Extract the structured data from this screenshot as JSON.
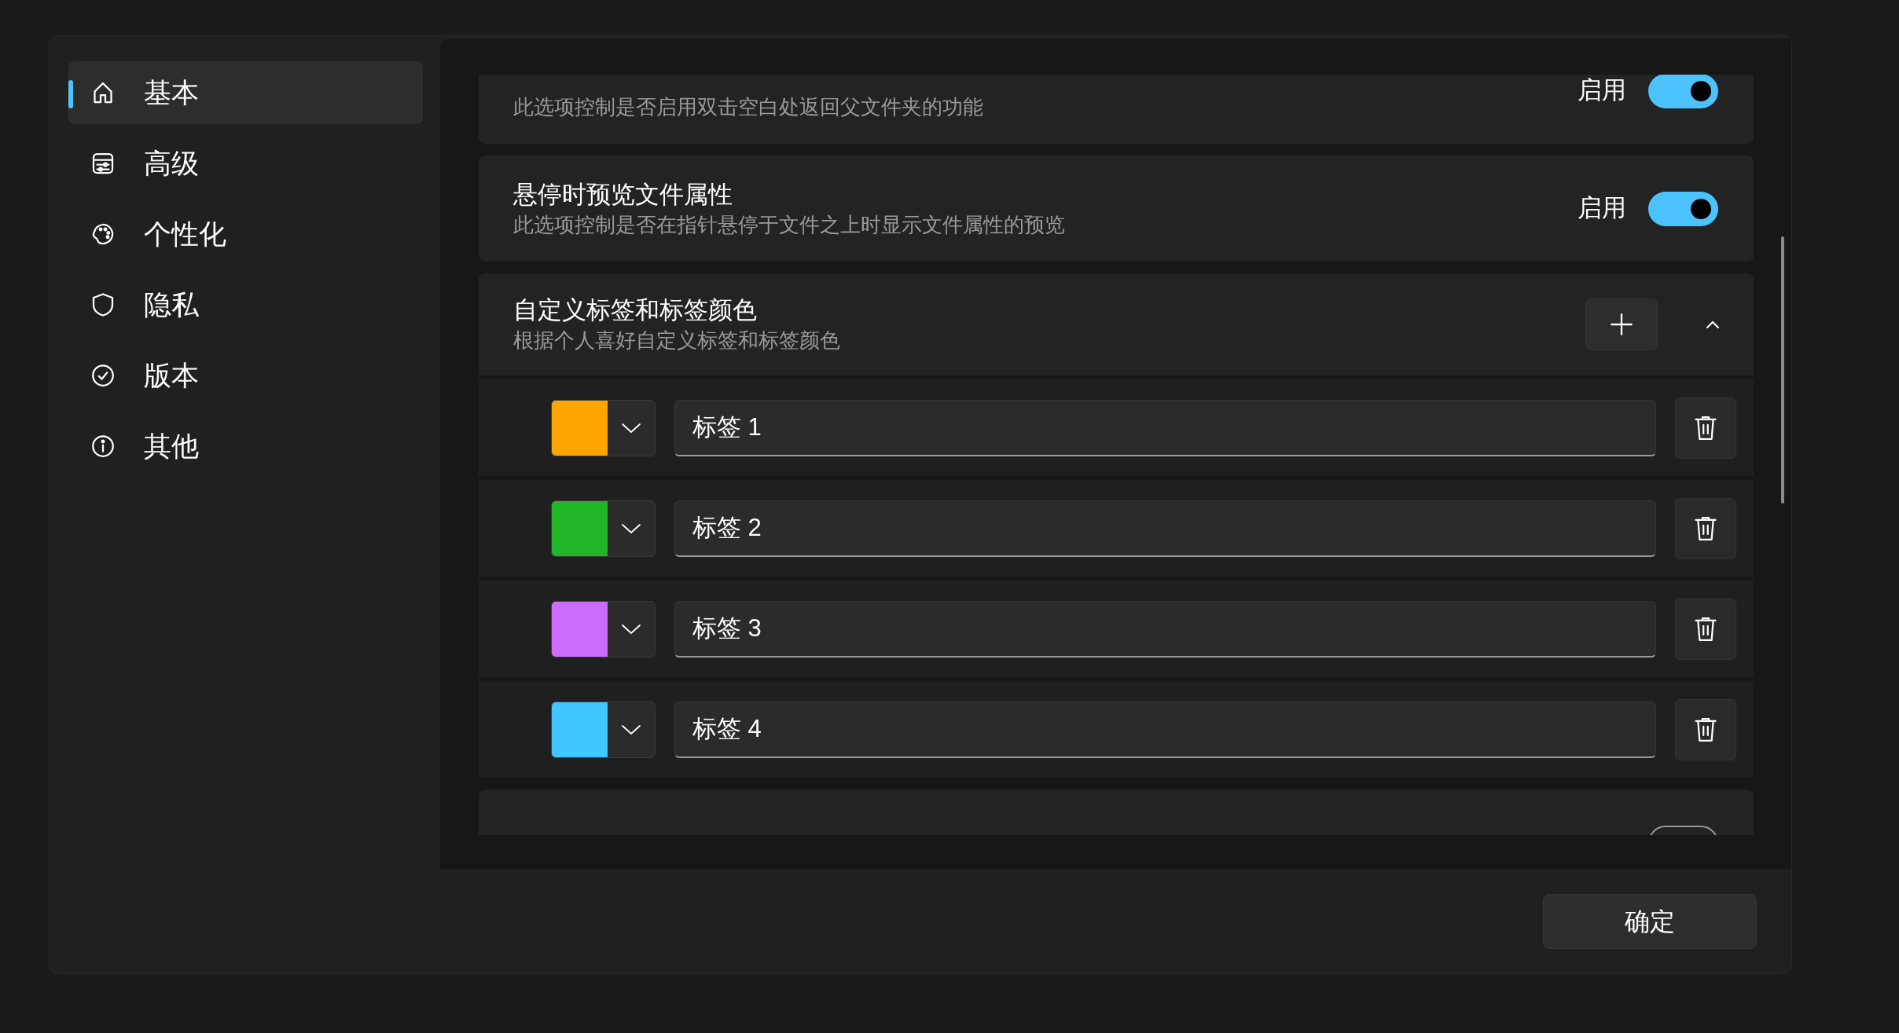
{
  "nav": [
    {
      "label": "基本",
      "selected": true
    },
    {
      "label": "高级",
      "selected": false
    },
    {
      "label": "个性化",
      "selected": false
    },
    {
      "label": "隐私",
      "selected": false
    },
    {
      "label": "版本",
      "selected": false
    },
    {
      "label": "其他",
      "selected": false
    }
  ],
  "settings": [
    {
      "kind": "toggle",
      "description": "此选项控制是否启用双击空白处返回父文件夹的功能",
      "state_label": "启用",
      "on": true
    },
    {
      "kind": "toggle",
      "title": "悬停时预览文件属性",
      "description": "此选项控制是否在指针悬停于文件之上时显示文件属性的预览",
      "state_label": "启用",
      "on": true
    },
    {
      "kind": "expander",
      "title": "自定义标签和标签颜色",
      "description": "根据个人喜好自定义标签和标签颜色",
      "expanded": true,
      "tags": [
        {
          "color": "#ffa500",
          "name": "标签 1"
        },
        {
          "color": "#22b527",
          "name": "标签 2"
        },
        {
          "color": "#cc6cff",
          "name": "标签 3"
        },
        {
          "color": "#42c6ff",
          "name": "标签 4"
        }
      ]
    },
    {
      "kind": "toggle",
      "on": false
    }
  ],
  "ok_button": "确定"
}
